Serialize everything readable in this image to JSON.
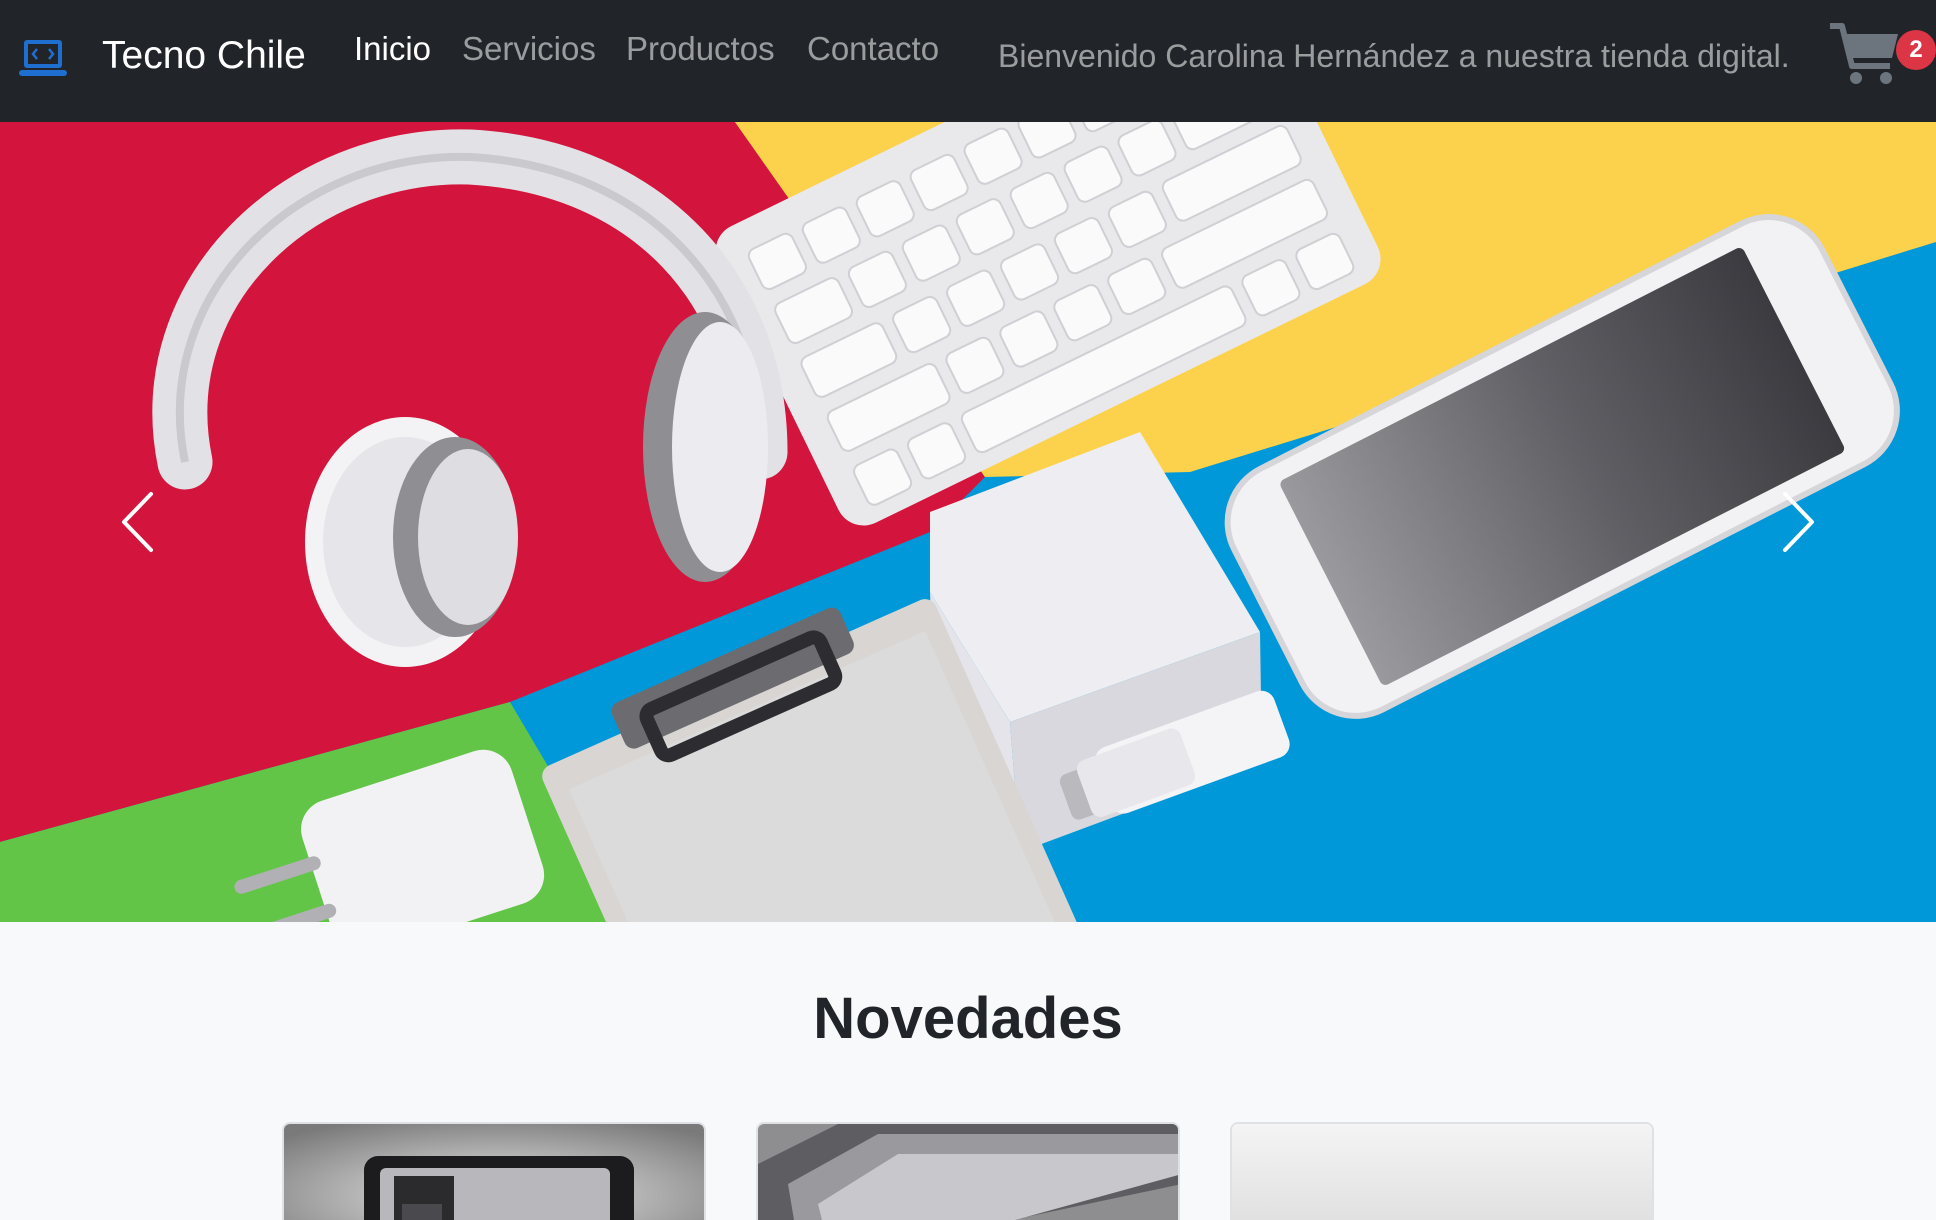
{
  "navbar": {
    "brand": "Tecno Chile",
    "brand_icon": "laptop-code-icon",
    "links": [
      {
        "label": "Inicio",
        "active": true
      },
      {
        "label": "Servicios",
        "active": false
      },
      {
        "label": "Productos",
        "active": false
      },
      {
        "label": "Contacto",
        "active": false
      }
    ],
    "welcome": "Bienvenido Carolina Hernández a nuestra tienda digital.",
    "cart_icon": "shopping-cart-icon",
    "cart_count": "2"
  },
  "carousel": {
    "prev_icon": "chevron-left-icon",
    "next_icon": "chevron-right-icon"
  },
  "novedades": {
    "title": "Novedades"
  },
  "colors": {
    "navbar_bg": "#212529",
    "brand_icon": "#0d6efd",
    "badge": "#dc3545",
    "page_bg": "#f8f9fa"
  }
}
